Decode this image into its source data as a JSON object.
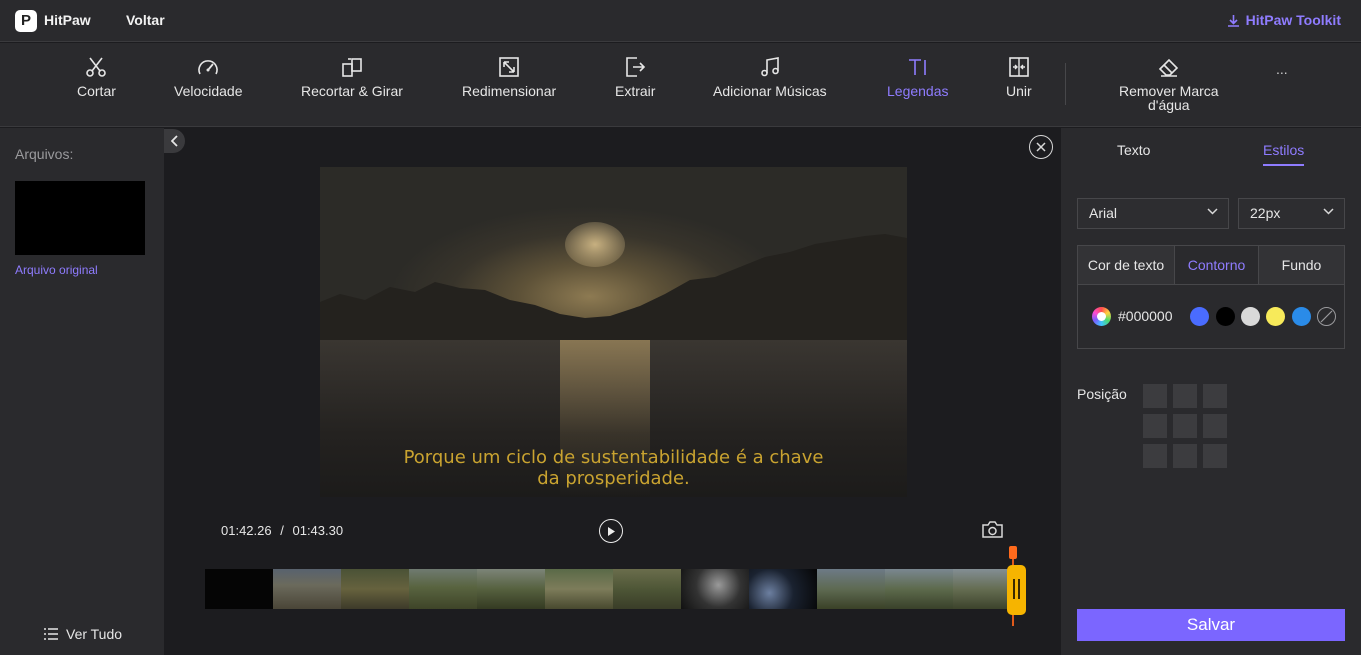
{
  "topbar": {
    "logo_glyph": "P",
    "app_name": "HitPaw",
    "back_label": "Voltar",
    "toolkit_label": "HitPaw Toolkit"
  },
  "toolbar": {
    "tools": [
      {
        "label": "Cortar",
        "icon": "scissors-icon"
      },
      {
        "label": "Velocidade",
        "icon": "speedometer-icon"
      },
      {
        "label": "Recortar & Girar",
        "icon": "crop-rotate-icon"
      },
      {
        "label": "Redimensionar",
        "icon": "resize-icon"
      },
      {
        "label": "Extrair",
        "icon": "export-icon"
      },
      {
        "label": "Adicionar Músicas",
        "icon": "music-note-icon"
      },
      {
        "label": "Legendas",
        "icon": "subtitle-text-icon",
        "active": true
      },
      {
        "label": "Unir",
        "icon": "merge-icon"
      },
      {
        "label": "Remover Marca\nd'água",
        "icon": "eraser-icon"
      }
    ],
    "more_label": "..."
  },
  "left_panel": {
    "files_label": "Arquivos:",
    "file_name": "Arquivo original",
    "view_all_label": "Ver Tudo"
  },
  "player": {
    "subtitle_line1": "Porque um ciclo de sustentabilidade é a chave",
    "subtitle_line2": "da prosperidade.",
    "current_time": "01:42.26",
    "time_separator": "/",
    "total_time": "01:43.30",
    "progress_fraction": 0.99
  },
  "right_panel": {
    "tabs": [
      "Texto",
      "Estilos"
    ],
    "active_tab": "Estilos",
    "font_family": "Arial",
    "font_size": "22px",
    "color_tabs": [
      "Cor de texto",
      "Contorno",
      "Fundo"
    ],
    "active_color_tab": "Contorno",
    "hex_value": "#000000",
    "swatches": [
      "#4a6cff",
      "#000000",
      "#d9d9d9",
      "#f7ea5a",
      "#2a8be8",
      "none"
    ],
    "position_label": "Posição",
    "save_label": "Salvar"
  },
  "colors": {
    "accent": "#8f7cff",
    "button": "#7b66ff",
    "subtitle_text": "#c9a330",
    "playhead": "#f6b400"
  }
}
